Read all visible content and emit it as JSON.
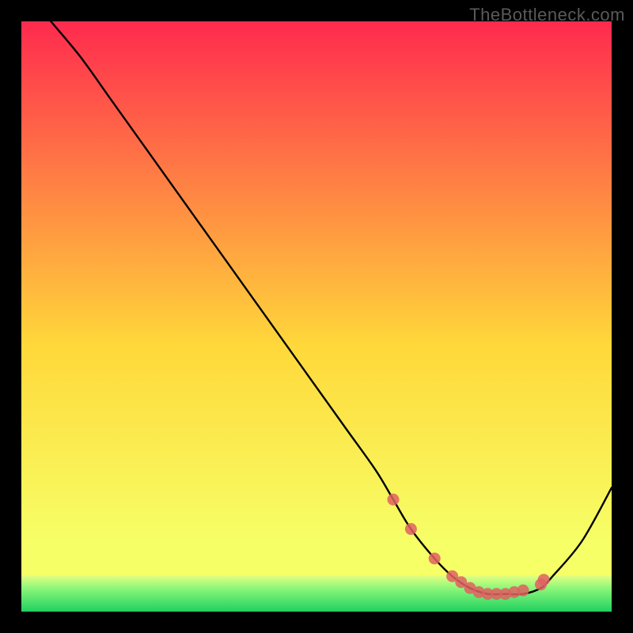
{
  "watermark": "TheBottleneck.com",
  "chart_data": {
    "type": "line",
    "title": "",
    "xlabel": "",
    "ylabel": "",
    "xlim": [
      0,
      100
    ],
    "ylim": [
      0,
      100
    ],
    "series": [
      {
        "name": "bottleneck-curve",
        "x": [
          5,
          10,
          15,
          20,
          25,
          30,
          35,
          40,
          45,
          50,
          55,
          60,
          63,
          66,
          70,
          73,
          76,
          79,
          82,
          85,
          88,
          90,
          95,
          100
        ],
        "y": [
          100,
          94,
          87,
          80,
          73,
          66,
          59,
          52,
          45,
          38,
          31,
          24,
          19,
          14,
          9,
          6,
          4,
          3,
          3,
          3,
          4,
          6,
          12,
          21
        ]
      }
    ],
    "markers": {
      "name": "highlight-dots",
      "x": [
        63,
        66,
        70,
        73,
        74.5,
        76,
        77.5,
        79,
        80.5,
        82,
        83.5,
        85,
        88,
        88.5
      ],
      "y": [
        19,
        14,
        9,
        6,
        5,
        4,
        3.3,
        3,
        3,
        3,
        3.3,
        3.6,
        4.6,
        5.4
      ]
    },
    "background": {
      "gradient_top": "#ff2a4e",
      "gradient_mid": "#ffd83a",
      "gradient_low": "#f6ff66",
      "green_band": "#20d060"
    }
  }
}
